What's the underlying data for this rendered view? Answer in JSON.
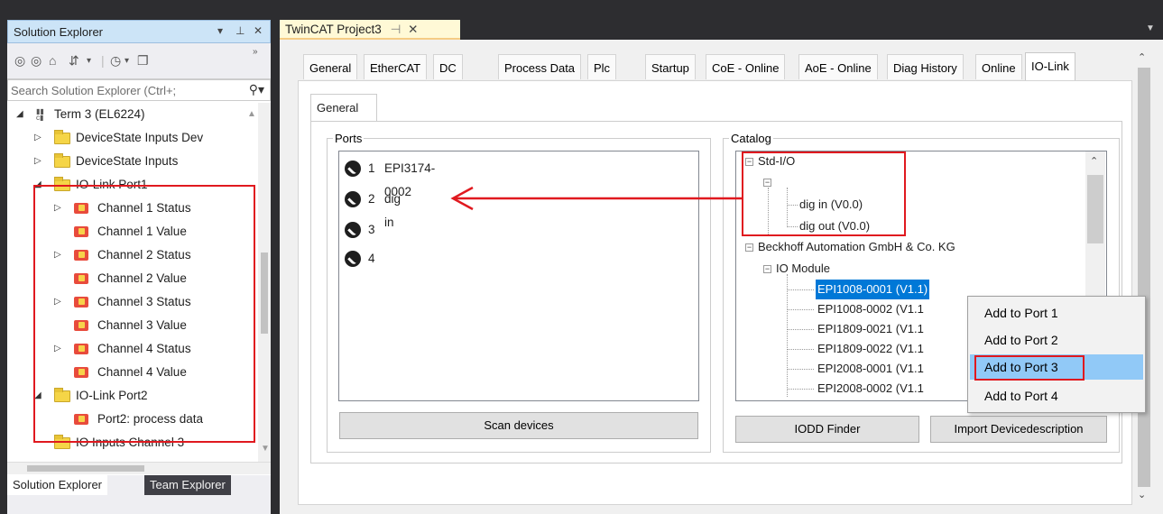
{
  "solution_explorer": {
    "title": "Solution Explorer",
    "title_controls": [
      "▾",
      "⊥",
      "✕"
    ],
    "search_placeholder": "Search Solution Explorer (Ctrl+;",
    "tree": [
      {
        "label": "Term 3 (EL6224)",
        "icon": "terminal-icon"
      },
      {
        "label": "DeviceState Inputs Dev",
        "icon": "folder-icon"
      },
      {
        "label": "DeviceState Inputs",
        "icon": "folder-icon"
      },
      {
        "label": "IO-Link Port1",
        "icon": "folder-icon"
      },
      {
        "label": "Channel 1 Status",
        "icon": "variable-icon"
      },
      {
        "label": "Channel 1 Value",
        "icon": "variable-icon"
      },
      {
        "label": "Channel 2 Status",
        "icon": "variable-icon"
      },
      {
        "label": "Channel 2 Value",
        "icon": "variable-icon"
      },
      {
        "label": "Channel 3 Status",
        "icon": "variable-icon"
      },
      {
        "label": "Channel 3 Value",
        "icon": "variable-icon"
      },
      {
        "label": "Channel 4 Status",
        "icon": "variable-icon"
      },
      {
        "label": "Channel 4 Value",
        "icon": "variable-icon"
      },
      {
        "label": "IO-Link Port2",
        "icon": "folder-icon"
      },
      {
        "label": "Port2: process data",
        "icon": "variable-icon"
      },
      {
        "label": "IO Inputs Channel 3",
        "icon": "folder-icon"
      }
    ],
    "bottom_tabs": [
      "Solution Explorer",
      "Team Explorer"
    ]
  },
  "document": {
    "tab_title": "TwinCAT Project3",
    "tab_pin": "⊣",
    "tab_close": "✕",
    "tabs": [
      "General",
      "EtherCAT",
      "DC",
      "Process Data",
      "Plc",
      "Startup",
      "CoE - Online",
      "AoE - Online",
      "Diag History",
      "Online",
      "IO-Link"
    ],
    "active_tab": "IO-Link",
    "subtab": "General",
    "ports_label": "Ports",
    "ports": [
      {
        "num": "1",
        "name": "EPI3174-0002"
      },
      {
        "num": "2",
        "name": "dig in"
      },
      {
        "num": "3",
        "name": ""
      },
      {
        "num": "4",
        "name": ""
      }
    ],
    "scan_button": "Scan devices",
    "catalog_label": "Catalog",
    "catalog": {
      "std_io": "Std-I/O",
      "dig_in": "dig in (V0.0)",
      "dig_out": "dig out (V0.0)",
      "vendor": "Beckhoff Automation GmbH & Co. KG",
      "io_module": "IO Module",
      "devices": [
        "EPI1008-0001 (V1.1)",
        "EPI1008-0002 (V1.1",
        "EPI1809-0021 (V1.1",
        "EPI1809-0022 (V1.1",
        "EPI2008-0001 (V1.1",
        "EPI2008-0002 (V1.1"
      ]
    },
    "iodd_button": "IODD Finder",
    "import_button": "Import Devicedescription"
  },
  "context_menu": {
    "items": [
      "Add to Port 1",
      "Add to Port 2",
      "Add to Port 3",
      "Add to Port 4"
    ],
    "highlighted": "Add to Port 3"
  },
  "colors": {
    "highlight_red": "#e0191f",
    "selection_blue": "#0078d7",
    "menu_hover": "#91c9f7"
  }
}
